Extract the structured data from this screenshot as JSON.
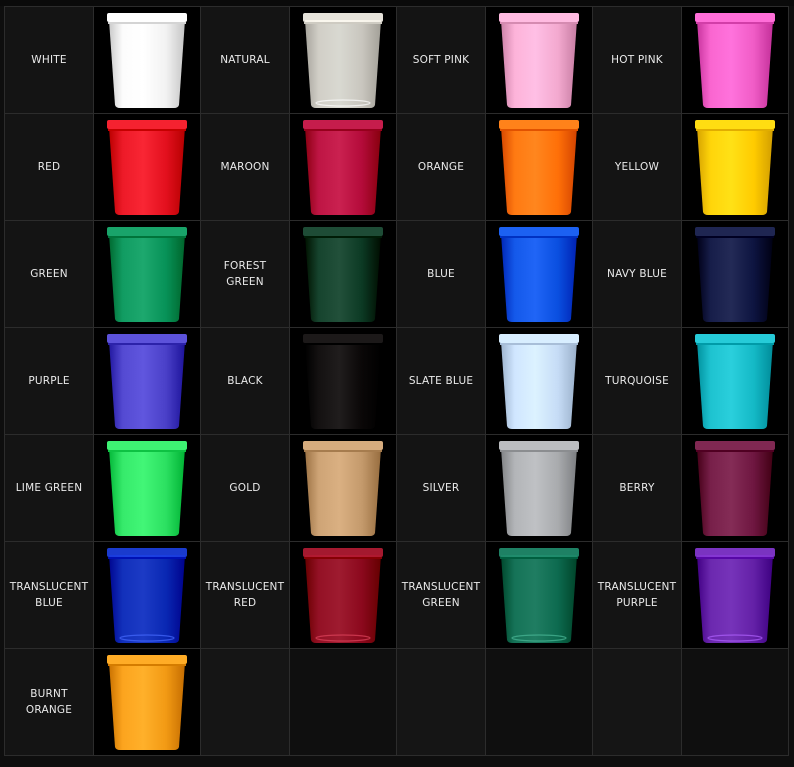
{
  "colors": [
    {
      "name": "WHITE",
      "hex": "#f2f2f2",
      "translucent": false
    },
    {
      "name": "NATURAL",
      "hex": "#ece9e0",
      "translucent": true
    },
    {
      "name": "SOFT PINK",
      "hex": "#f3a9cf",
      "translucent": false
    },
    {
      "name": "HOT PINK",
      "hex": "#f05cc6",
      "translucent": false
    },
    {
      "name": "RED",
      "hex": "#e3101e",
      "translucent": false
    },
    {
      "name": "MAROON",
      "hex": "#b40b3a",
      "translucent": false
    },
    {
      "name": "ORANGE",
      "hex": "#ff7008",
      "translucent": false
    },
    {
      "name": "YELLOW",
      "hex": "#ffcb00",
      "translucent": false
    },
    {
      "name": "GREEN",
      "hex": "#079258",
      "translucent": false
    },
    {
      "name": "FOREST GREEN",
      "hex": "#0c3a24",
      "translucent": false
    },
    {
      "name": "BLUE",
      "hex": "#0a4fe0",
      "translucent": false
    },
    {
      "name": "NAVY BLUE",
      "hex": "#0d1440",
      "translucent": false
    },
    {
      "name": "PURPLE",
      "hex": "#4a40c8",
      "translucent": false
    },
    {
      "name": "BLACK",
      "hex": "#0a0707",
      "translucent": false
    },
    {
      "name": "SLATE BLUE",
      "hex": "#c6dcf6",
      "translucent": false
    },
    {
      "name": "TURQUOISE",
      "hex": "#14b9c6",
      "translucent": false
    },
    {
      "name": "LIME GREEN",
      "hex": "#2ce061",
      "translucent": false
    },
    {
      "name": "GOLD",
      "hex": "#c49a6c",
      "translucent": false
    },
    {
      "name": "SILVER",
      "hex": "#a9abae",
      "translucent": false
    },
    {
      "name": "BERRY",
      "hex": "#6e1640",
      "translucent": false
    },
    {
      "name": "TRANSLUCENT BLUE",
      "hex": "#0b2fd2",
      "translucent": true
    },
    {
      "name": "TRANSLUCENT RED",
      "hex": "#a40a22",
      "translucent": true
    },
    {
      "name": "TRANSLUCENT GREEN",
      "hex": "#0f7d5d",
      "translucent": true
    },
    {
      "name": "TRANSLUCENT PURPLE",
      "hex": "#7526c4",
      "translucent": true
    },
    {
      "name": "BURNT ORANGE",
      "hex": "#f29a14",
      "translucent": false
    }
  ]
}
